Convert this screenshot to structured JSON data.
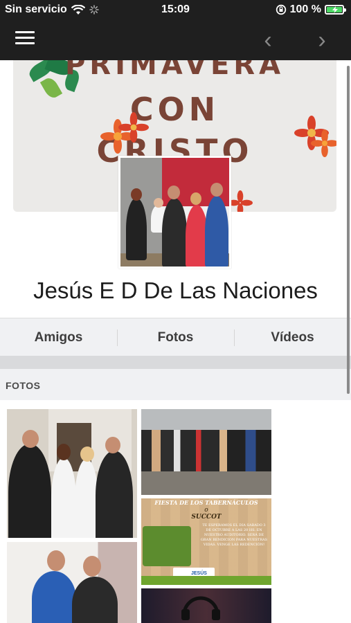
{
  "status_bar": {
    "carrier": "Sin servicio",
    "time": "15:09",
    "battery_percent": "100 %",
    "battery_level": 1.0
  },
  "nav": {
    "back_glyph": "‹",
    "forward_glyph": "›"
  },
  "cover": {
    "line1": "PRIMAVERA",
    "line2": "CON",
    "line3": "CRISTO"
  },
  "profile": {
    "name": "Jesús E D De Las Naciones"
  },
  "tabs": [
    {
      "label": "Amigos"
    },
    {
      "label": "Fotos"
    },
    {
      "label": "Vídeos"
    }
  ],
  "photos_section": {
    "title": "FOTOS",
    "photo_caption": {
      "title": "FIESTA DE LOS TABERNÁCULOS",
      "conj": "o",
      "subtitle": "SUCCOT",
      "body": "TE ESPERAMOS EL DIA SABADO 3 DE OCTUBRE A LAS 20 HS. EN NUESTRO AUDITORIO. SERÁ DE GRAN BENDICION PARA NUESTRAS VIDAS. VENGE LAS REDENCIÓN!",
      "logo_text": "JESÚS"
    }
  },
  "colors": {
    "bar_bg": "#1f1f1f",
    "cover_text": "#7a4436",
    "tabs_bg": "#f0f1f3"
  },
  "icons": [
    "wifi-icon",
    "activity-spinner-icon",
    "orientation-lock-icon",
    "battery-charging-icon",
    "hamburger-menu-icon",
    "back-arrow-icon",
    "forward-arrow-icon"
  ]
}
